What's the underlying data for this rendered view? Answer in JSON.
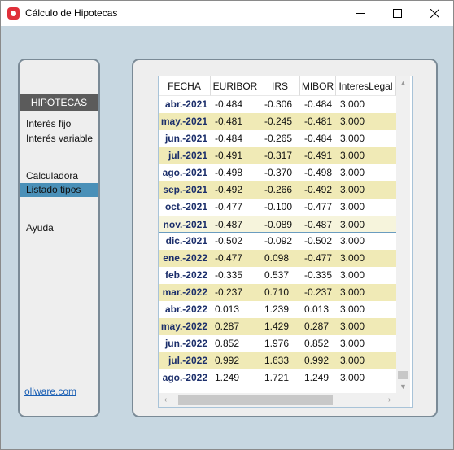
{
  "window": {
    "title": "Cálculo de Hipotecas",
    "controls": {
      "minimize_icon": "minimize-icon",
      "maximize_icon": "maximize-icon",
      "close_icon": "close-icon"
    }
  },
  "sidebar": {
    "header": "HIPOTECAS",
    "items": [
      {
        "label": "Interés fijo",
        "active": false
      },
      {
        "label": "Interés variable",
        "active": false
      },
      {
        "label": "Calculadora",
        "active": false
      },
      {
        "label": "Listado tipos",
        "active": true
      },
      {
        "label": "Ayuda",
        "active": false
      }
    ],
    "link": "oliware.com"
  },
  "table": {
    "columns": [
      "FECHA",
      "EURIBOR",
      "IRS",
      "MIBOR",
      "InteresLegal"
    ],
    "rows": [
      [
        "abr.-2021",
        "-0.484",
        "-0.306",
        "-0.484",
        "3.000"
      ],
      [
        "may.-2021",
        "-0.481",
        "-0.245",
        "-0.481",
        "3.000"
      ],
      [
        "jun.-2021",
        "-0.484",
        "-0.265",
        "-0.484",
        "3.000"
      ],
      [
        "jul.-2021",
        "-0.491",
        "-0.317",
        "-0.491",
        "3.000"
      ],
      [
        "ago.-2021",
        "-0.498",
        "-0.370",
        "-0.498",
        "3.000"
      ],
      [
        "sep.-2021",
        "-0.492",
        "-0.266",
        "-0.492",
        "3.000"
      ],
      [
        "oct.-2021",
        "-0.477",
        "-0.100",
        "-0.477",
        "3.000"
      ],
      [
        "nov.-2021",
        "-0.487",
        "-0.089",
        "-0.487",
        "3.000"
      ],
      [
        "dic.-2021",
        "-0.502",
        "-0.092",
        "-0.502",
        "3.000"
      ],
      [
        "ene.-2022",
        "-0.477",
        "0.098",
        "-0.477",
        "3.000"
      ],
      [
        "feb.-2022",
        "-0.335",
        "0.537",
        "-0.335",
        "3.000"
      ],
      [
        "mar.-2022",
        "-0.237",
        "0.710",
        "-0.237",
        "3.000"
      ],
      [
        "abr.-2022",
        "0.013",
        "1.239",
        "0.013",
        "3.000"
      ],
      [
        "may.-2022",
        "0.287",
        "1.429",
        "0.287",
        "3.000"
      ],
      [
        "jun.-2022",
        "0.852",
        "1.976",
        "0.852",
        "3.000"
      ],
      [
        "jul.-2022",
        "0.992",
        "1.633",
        "0.992",
        "3.000"
      ],
      [
        "ago.-2022",
        "1.249",
        "1.721",
        "1.249",
        "3.000"
      ]
    ],
    "selected_row": 7,
    "scroll": {
      "up_icon": "chevron-up-icon",
      "down_icon": "chevron-down-icon",
      "left_icon": "chevron-left-icon",
      "right_icon": "chevron-right-icon"
    }
  },
  "colors": {
    "background": "#c7d7e1",
    "alt_row": "#f0eab6",
    "selection": "#4a90b8",
    "date_text": "#1c2f6b",
    "link": "#1a5fb4"
  }
}
